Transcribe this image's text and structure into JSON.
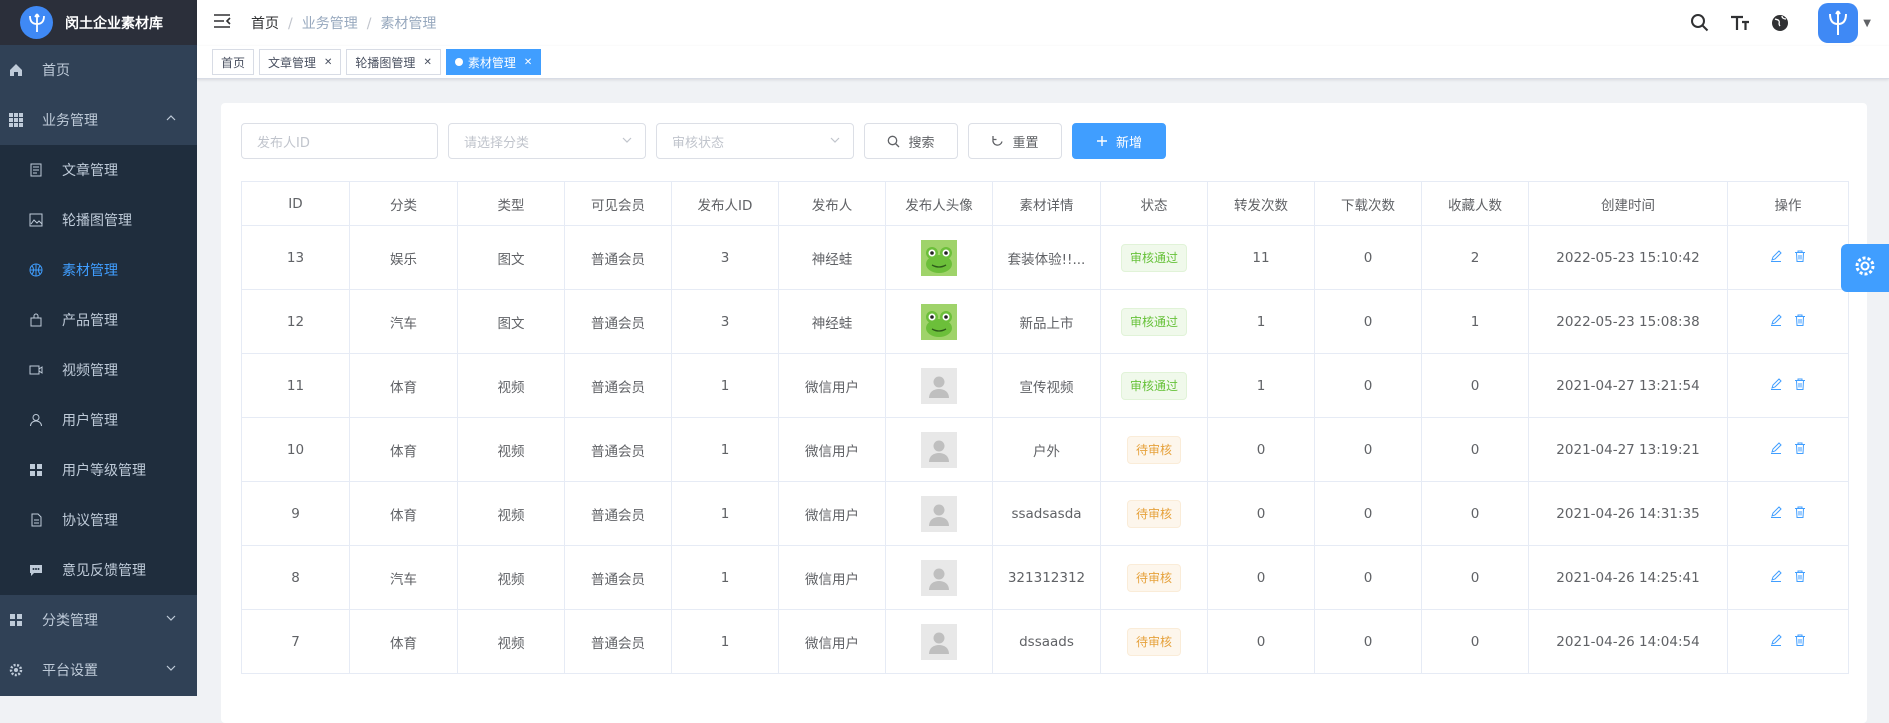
{
  "app": {
    "title": "闵土企业素材库"
  },
  "sidebar": {
    "items": [
      {
        "label": "首页",
        "icon": "home-icon"
      },
      {
        "label": "业务管理",
        "icon": "grid-icon",
        "expanded": true,
        "children": [
          {
            "label": "文章管理",
            "icon": "article-icon"
          },
          {
            "label": "轮播图管理",
            "icon": "image-icon"
          },
          {
            "label": "素材管理",
            "icon": "basketball-icon",
            "active": true
          },
          {
            "label": "产品管理",
            "icon": "bag-icon"
          },
          {
            "label": "视频管理",
            "icon": "video-icon"
          },
          {
            "label": "用户管理",
            "icon": "user-icon"
          },
          {
            "label": "用户等级管理",
            "icon": "grid-icon"
          },
          {
            "label": "协议管理",
            "icon": "document-icon"
          },
          {
            "label": "意见反馈管理",
            "icon": "chat-icon"
          }
        ]
      },
      {
        "label": "分类管理",
        "icon": "grid-icon"
      },
      {
        "label": "平台设置",
        "icon": "gear-icon"
      }
    ]
  },
  "breadcrumb": [
    "首页",
    "业务管理",
    "素材管理"
  ],
  "tags": [
    {
      "label": "首页",
      "closable": false
    },
    {
      "label": "文章管理",
      "closable": true
    },
    {
      "label": "轮播图管理",
      "closable": true
    },
    {
      "label": "素材管理",
      "closable": true,
      "active": true
    }
  ],
  "filters": {
    "publisher_id_placeholder": "发布人ID",
    "category_placeholder": "请选择分类",
    "status_placeholder": "审核状态",
    "search_label": "搜索",
    "reset_label": "重置",
    "add_label": "新增"
  },
  "table": {
    "columns": [
      "ID",
      "分类",
      "类型",
      "可见会员",
      "发布人ID",
      "发布人",
      "发布人头像",
      "素材详情",
      "状态",
      "转发次数",
      "下载次数",
      "收藏人数",
      "创建时间",
      "操作"
    ],
    "rows": [
      {
        "id": "13",
        "category": "娱乐",
        "type": "图文",
        "member": "普通会员",
        "pub_id": "3",
        "publisher": "神经蛙",
        "avatar": "frog",
        "detail": "套装体验!!...",
        "status": "审核通过",
        "status_kind": "ok",
        "forward": "11",
        "download": "0",
        "fav": "2",
        "created": "2022-05-23 15:10:42"
      },
      {
        "id": "12",
        "category": "汽车",
        "type": "图文",
        "member": "普通会员",
        "pub_id": "3",
        "publisher": "神经蛙",
        "avatar": "frog",
        "detail": "新品上市",
        "status": "审核通过",
        "status_kind": "ok",
        "forward": "1",
        "download": "0",
        "fav": "1",
        "created": "2022-05-23 15:08:38"
      },
      {
        "id": "11",
        "category": "体育",
        "type": "视频",
        "member": "普通会员",
        "pub_id": "1",
        "publisher": "微信用户",
        "avatar": "default",
        "detail": "宣传视频",
        "status": "审核通过",
        "status_kind": "ok",
        "forward": "1",
        "download": "0",
        "fav": "0",
        "created": "2021-04-27 13:21:54"
      },
      {
        "id": "10",
        "category": "体育",
        "type": "视频",
        "member": "普通会员",
        "pub_id": "1",
        "publisher": "微信用户",
        "avatar": "default",
        "detail": "户外",
        "status": "待审核",
        "status_kind": "wait",
        "forward": "0",
        "download": "0",
        "fav": "0",
        "created": "2021-04-27 13:19:21"
      },
      {
        "id": "9",
        "category": "体育",
        "type": "视频",
        "member": "普通会员",
        "pub_id": "1",
        "publisher": "微信用户",
        "avatar": "default",
        "detail": "ssadsasda",
        "status": "待审核",
        "status_kind": "wait",
        "forward": "0",
        "download": "0",
        "fav": "0",
        "created": "2021-04-26 14:31:35"
      },
      {
        "id": "8",
        "category": "汽车",
        "type": "视频",
        "member": "普通会员",
        "pub_id": "1",
        "publisher": "微信用户",
        "avatar": "default",
        "detail": "321312312",
        "status": "待审核",
        "status_kind": "wait",
        "forward": "0",
        "download": "0",
        "fav": "0",
        "created": "2021-04-26 14:25:41"
      },
      {
        "id": "7",
        "category": "体育",
        "type": "视频",
        "member": "普通会员",
        "pub_id": "1",
        "publisher": "微信用户",
        "avatar": "default",
        "detail": "dssaads",
        "status": "待审核",
        "status_kind": "wait",
        "forward": "0",
        "download": "0",
        "fav": "0",
        "created": "2021-04-26 14:04:54"
      }
    ]
  },
  "colors": {
    "primary": "#409eff",
    "sidebar_bg": "#304156",
    "ok": "#67c23a",
    "wait": "#e6a23c"
  }
}
